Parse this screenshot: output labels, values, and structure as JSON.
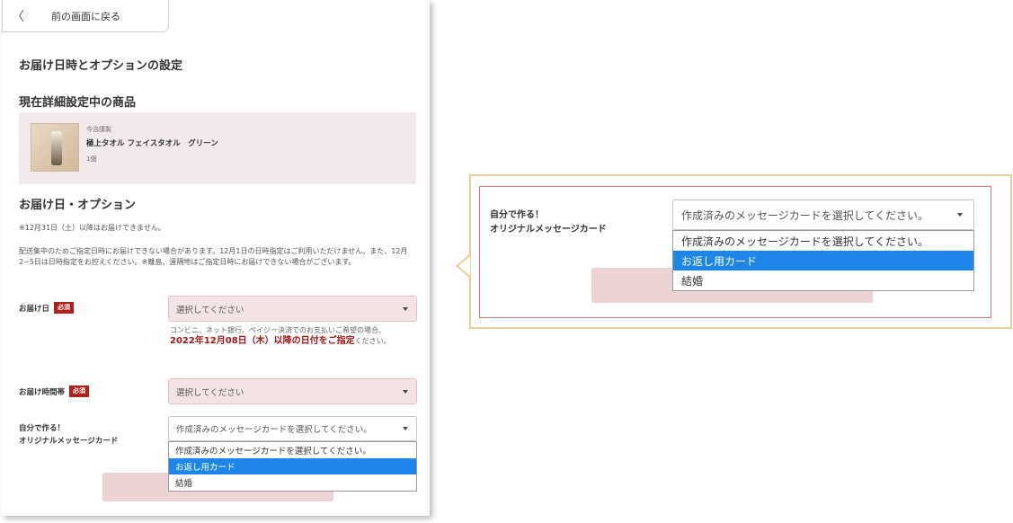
{
  "back_button": {
    "label": "前の画面に戻る"
  },
  "page_title": "お届け日時とオプションの設定",
  "current_product": {
    "heading": "現在詳細設定中の商品",
    "brand": "今治謹製",
    "name": "極上タオル フェイスタオル　グリーン",
    "quantity": "1個"
  },
  "delivery_options": {
    "heading": "お届け日・オプション",
    "note1": "※12月31日（土）以降はお届けできません。",
    "note2": "配送集中のためご指定日時にお届けできない場合があります。12月1日の日時指定はご利用いただけません。また、12月2~5日は日時指定をお控えください。※離島、遠隔地はご指定日時にお届けできない場合がございます。",
    "required_badge": "必須",
    "delivery_date": {
      "label": "お届け日",
      "placeholder": "選択してください",
      "hint": "コンビニ、ネット銀行、ペイジー決済でのお支払いご希望の場合、",
      "hint_strong": "2022年12月08日（木）以降の日付をご指定",
      "hint_tail": "ください。"
    },
    "delivery_time": {
      "label": "お届け時間帯",
      "placeholder": "選択してください"
    },
    "message_card": {
      "label_line1": "自分で作る！",
      "label_line2": "オリジナルメッセージカード",
      "selected": "作成済みのメッセージカードを選択してください。",
      "options": [
        "作成済みのメッセージカードを選択してください。",
        "お返し用カード",
        "結婚"
      ],
      "highlighted_index": 1
    }
  },
  "colors": {
    "accent_red": "#b01e1e",
    "highlight_blue": "#1e86e8",
    "pink_field": "#f4e3e4",
    "callout_border": "#e7cf99"
  }
}
